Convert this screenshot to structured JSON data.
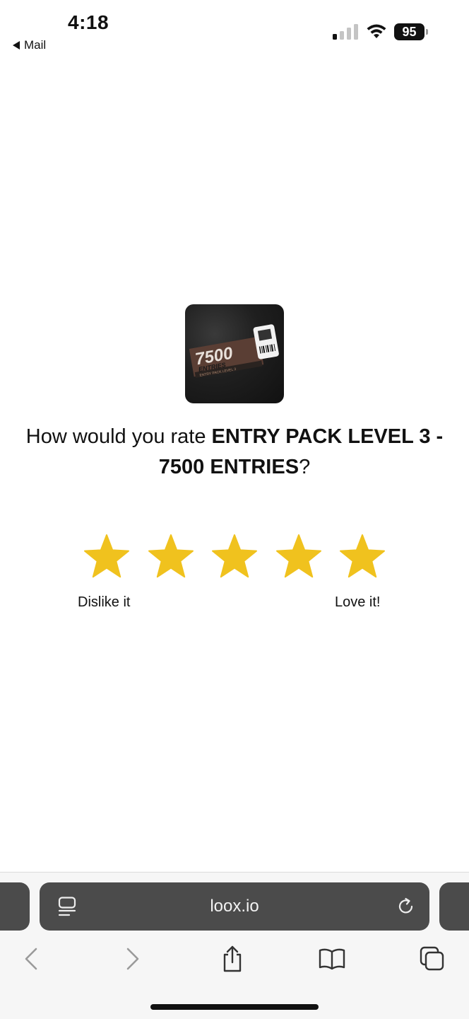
{
  "status_bar": {
    "time": "4:18",
    "back_app": "Mail",
    "battery_level": "95"
  },
  "product": {
    "image_text_big": "7500",
    "image_text_sub": "ENTRIES",
    "image_text_small": "ENTRY PACK LEVEL 3"
  },
  "question": {
    "prefix": "How would you rate ",
    "product_name": "ENTRY PACK LEVEL 3 - 7500 ENTRIES",
    "suffix": "?"
  },
  "rating": {
    "star_count": 5,
    "star_color": "#F0C21E",
    "low_label": "Dislike it",
    "high_label": "Love it!"
  },
  "browser": {
    "url": "loox.io",
    "icons": [
      "reader-icon",
      "reload-icon",
      "back-icon",
      "forward-icon",
      "share-icon",
      "bookmarks-icon",
      "tabs-icon"
    ]
  }
}
